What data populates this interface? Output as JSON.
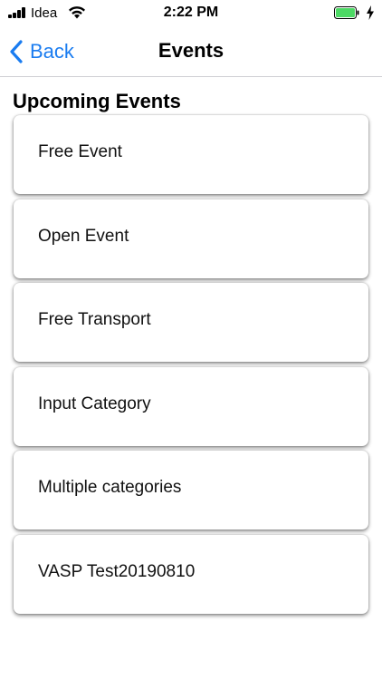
{
  "status_bar": {
    "carrier": "Idea",
    "time": "2:22 PM",
    "signal_icon": "signal-bars-icon",
    "wifi_icon": "wifi-icon",
    "battery_icon": "battery-icon",
    "battery_level": 1.0,
    "battery_color": "#4cd964"
  },
  "nav": {
    "back_label": "Back",
    "title": "Events",
    "accent_color": "#1a7cf0"
  },
  "section": {
    "title": "Upcoming Events"
  },
  "events": [
    {
      "label": "Free Event"
    },
    {
      "label": "Open Event"
    },
    {
      "label": "Free Transport"
    },
    {
      "label": "Input Category"
    },
    {
      "label": "Multiple categories"
    },
    {
      "label": "VASP Test20190810"
    }
  ]
}
